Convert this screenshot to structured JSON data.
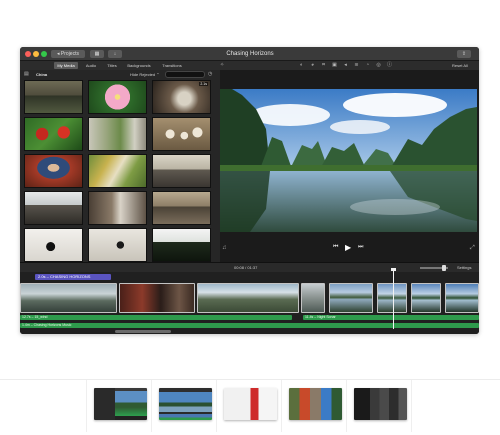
{
  "window": {
    "title": "Chasing Horizons",
    "projects_label": "◂ Projects",
    "share_icon": "share-icon"
  },
  "toolbar": {
    "tabs": [
      "My Media",
      "Audio",
      "Titles",
      "Backgrounds",
      "Transitions"
    ],
    "active_tab": "My Media",
    "reset_all_label": "Reset All",
    "adjustment_icons": [
      "color-balance-icon",
      "color-correction-icon",
      "crop-icon",
      "stabilization-icon",
      "volume-icon",
      "noise-reduction-icon",
      "speed-icon",
      "filter-icon",
      "info-icon"
    ]
  },
  "library": {
    "name": "China",
    "filter_label": "Hide Rejected ⌃",
    "clips": [
      {
        "scene": "boat-river",
        "badge": ""
      },
      {
        "scene": "pink-flower",
        "badge": ""
      },
      {
        "scene": "cooking-pot",
        "badge": "2.1s"
      },
      {
        "scene": "red-peppers",
        "badge": ""
      },
      {
        "scene": "market-vegetables",
        "badge": ""
      },
      {
        "scene": "dumplings",
        "badge": ""
      },
      {
        "scene": "woman-cooking",
        "badge": ""
      },
      {
        "scene": "vegetable-baskets",
        "badge": ""
      },
      {
        "scene": "street-motorbikes",
        "badge": ""
      },
      {
        "scene": "street-people",
        "badge": ""
      },
      {
        "scene": "alley-walk",
        "badge": ""
      },
      {
        "scene": "village-houses",
        "badge": ""
      },
      {
        "scene": "calligraphy-brush",
        "badge": ""
      },
      {
        "scene": "calligraphy-scroll",
        "badge": ""
      },
      {
        "scene": "tree-silhouette",
        "badge": ""
      }
    ]
  },
  "viewer": {
    "scene": "karst-mountains-lake",
    "timecode": "00:08 / 01:37"
  },
  "timeline": {
    "settings_label": "Settings",
    "title_clip": "2.0s – CHASING HORIZONS",
    "video_clips": [
      "mountains-fog",
      "alley-red",
      "village-roofs",
      "lake-reflection",
      "karst-lake-1",
      "karst-lake-2",
      "karst-lake-3",
      "karst-lake-4"
    ],
    "audio_tracks": [
      {
        "label": "12.7s – 15_wind"
      },
      {
        "label": "11.4s – Night Sonar"
      },
      {
        "label": "1.4m – Chasing Horizons Music"
      }
    ]
  },
  "carousel": {
    "slides": [
      "imovie-overview",
      "imovie-viewer",
      "imovie-titles",
      "imovie-media",
      "imovie-dark"
    ],
    "active_index": 0
  },
  "colors": {
    "title_clip": "#5a54c0",
    "audio_track": "#2e9a4c",
    "active_tab": "#5c5c5c"
  }
}
